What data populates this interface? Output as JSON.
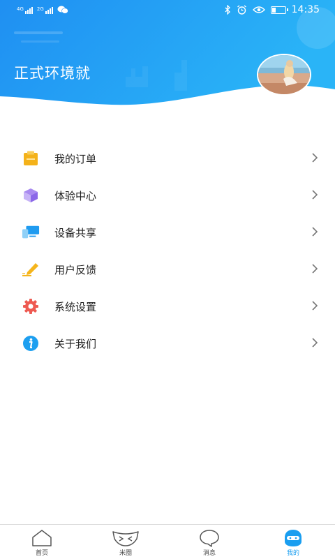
{
  "status_bar": {
    "net1": "4G",
    "net2": "2G",
    "time": "14:35"
  },
  "header": {
    "title": "正式环境就"
  },
  "menu": [
    {
      "label": "我的订单",
      "icon": "clipboard-icon"
    },
    {
      "label": "体验中心",
      "icon": "cube-icon"
    },
    {
      "label": "设备共享",
      "icon": "devices-icon"
    },
    {
      "label": "用户反馈",
      "icon": "pen-icon"
    },
    {
      "label": "系统设置",
      "icon": "gear-icon"
    },
    {
      "label": "关于我们",
      "icon": "info-icon"
    }
  ],
  "tabbar": [
    {
      "label": "首页",
      "icon": "home-icon"
    },
    {
      "label": "米圈",
      "icon": "mask-icon"
    },
    {
      "label": "消息",
      "icon": "chat-bubble-icon"
    },
    {
      "label": "我的",
      "icon": "profile-icon",
      "active": true
    }
  ],
  "colors": {
    "header_blue": "#1e93f3",
    "accent": "#1a9ef0"
  }
}
